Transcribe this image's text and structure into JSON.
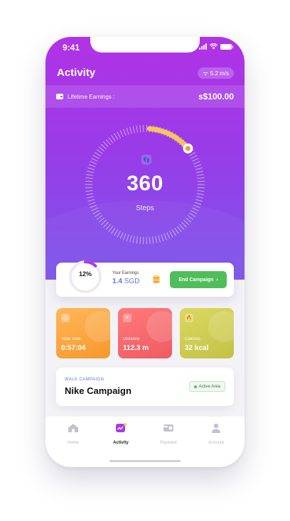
{
  "status_bar": {
    "time": "9:41"
  },
  "header": {
    "title": "Activity",
    "speed": "5.2 m/s"
  },
  "earnings_strip": {
    "label": "Lifetime Earnings :",
    "value": "s$100.00"
  },
  "steps": {
    "count": "360",
    "label": "Steps",
    "progress_fraction": 0.12
  },
  "campaign_card": {
    "percent": "12%",
    "percent_value": 0.12,
    "earnings_label": "Your Earnings",
    "earnings_amount": "1.4",
    "earnings_currency": "SGD",
    "end_button": "End Campaign",
    "end_button_chevron": "›"
  },
  "stats": [
    {
      "label": "Total Time",
      "value": "0:57:04",
      "icon": "clock-icon",
      "color": "#f6982c"
    },
    {
      "label": "Distance",
      "value": "112.3 m",
      "icon": "location-icon",
      "color": "#ee5b63"
    },
    {
      "label": "Calories",
      "value": "32 kcal",
      "icon": "flame-icon",
      "color": "#c3c247"
    }
  ],
  "walk_campaign": {
    "kicker": "WALK CAMPAIGN",
    "name": "Nike Campaign",
    "status": "Active Area"
  },
  "tabs": [
    {
      "label": "Home",
      "icon": "home-icon"
    },
    {
      "label": "Activity",
      "icon": "activity-icon",
      "active": true
    },
    {
      "label": "Payment",
      "icon": "payment-icon"
    },
    {
      "label": "Account",
      "icon": "account-icon"
    }
  ],
  "colors": {
    "brand_purple": "#a93ae8",
    "accent_blue": "#5a78ea",
    "success_green": "#4fbe5a",
    "arc_yellow": "#f7c55a"
  }
}
